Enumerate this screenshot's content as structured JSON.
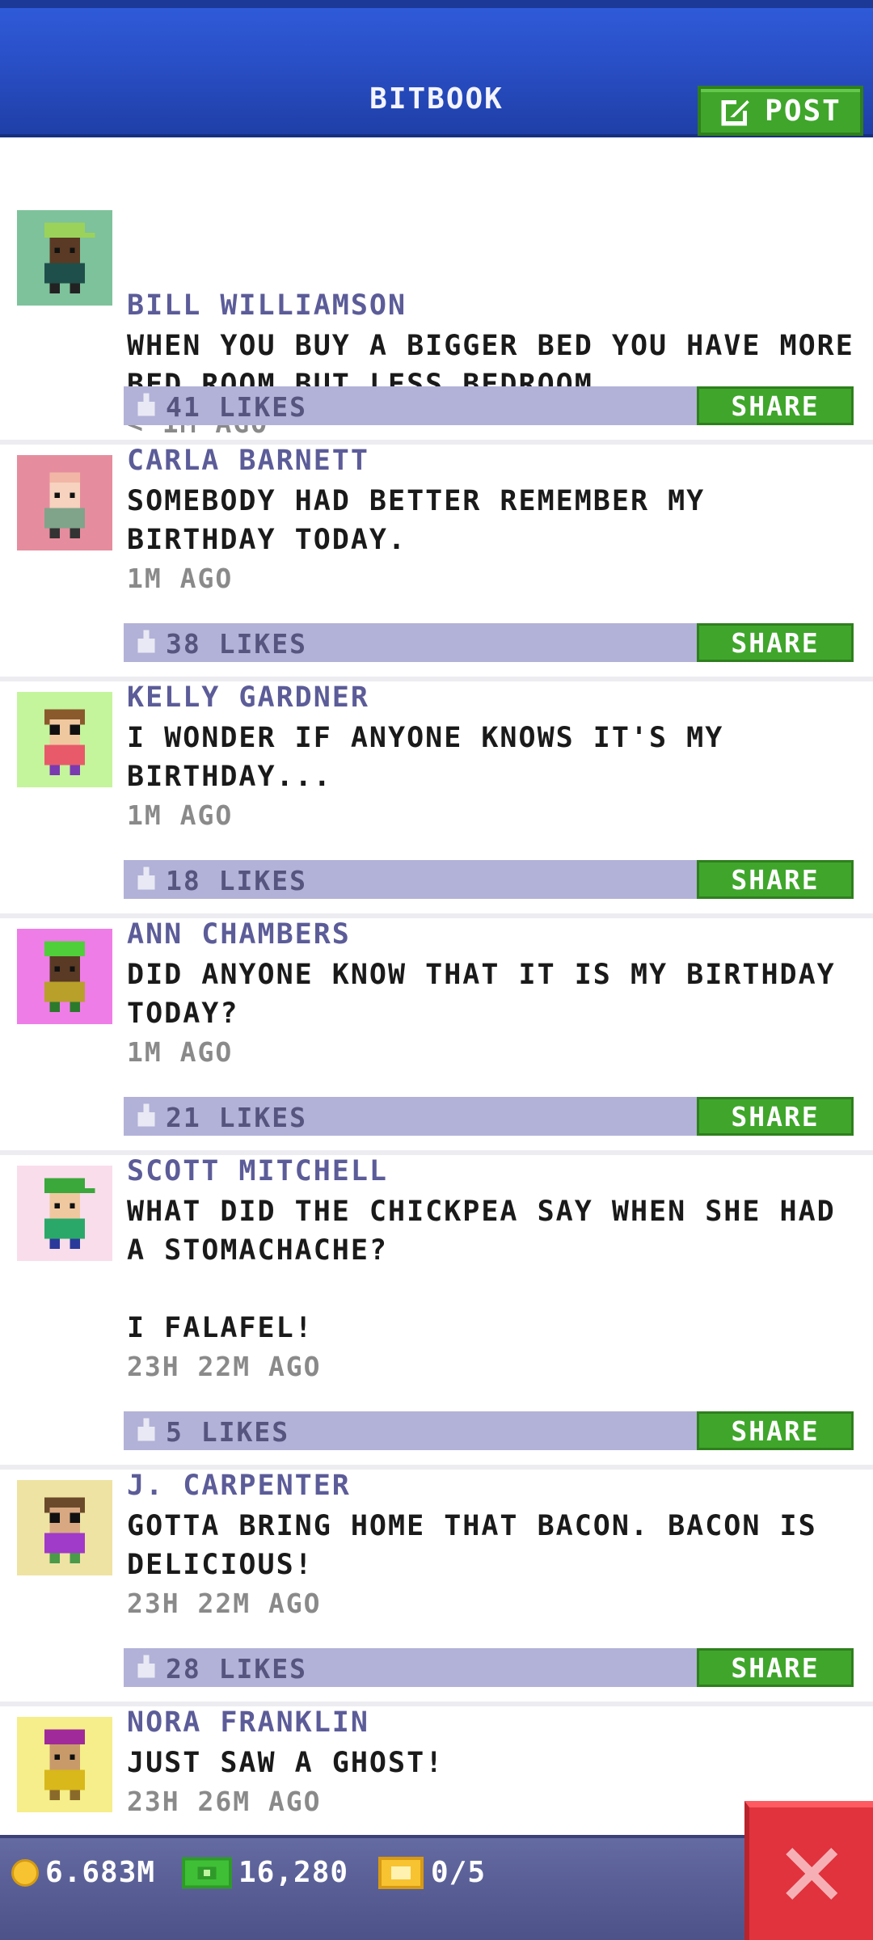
{
  "header": {
    "title": "BITBOOK",
    "post_label": "POST"
  },
  "posts": [
    {
      "name": "BILL WILLIAMSON",
      "message": "WHEN YOU BUY A BIGGER BED YOU HAVE MORE BED ROOM BUT LESS BEDROOM.",
      "time": "< 1M AGO",
      "likes": "41 LIKES",
      "share": "SHARE",
      "avatar_bg": "#7ec29b"
    },
    {
      "name": "CARLA BARNETT",
      "message": "SOMEBODY HAD BETTER REMEMBER MY BIRTHDAY TODAY.",
      "time": "1M AGO",
      "likes": "38 LIKES",
      "share": "SHARE",
      "avatar_bg": "#e58d9e"
    },
    {
      "name": "KELLY GARDNER",
      "message": "I WONDER IF ANYONE KNOWS IT'S MY BIRTHDAY...",
      "time": "1M AGO",
      "likes": "18 LIKES",
      "share": "SHARE",
      "avatar_bg": "#c4f59c"
    },
    {
      "name": "ANN CHAMBERS",
      "message": "DID ANYONE KNOW THAT IT IS MY BIRTHDAY TODAY?",
      "time": "1M AGO",
      "likes": "21 LIKES",
      "share": "SHARE",
      "avatar_bg": "#ef7de8"
    },
    {
      "name": "SCOTT MITCHELL",
      "message": "WHAT DID THE CHICKPEA SAY WHEN SHE HAD A STOMACHACHE?\n\nI FALAFEL!",
      "time": "23H 22M AGO",
      "likes": "5 LIKES",
      "share": "SHARE",
      "avatar_bg": "#f9ddeb"
    },
    {
      "name": "J. CARPENTER",
      "message": "GOTTA BRING HOME THAT BACON. BACON IS DELICIOUS!",
      "time": "23H 22M AGO",
      "likes": "28 LIKES",
      "share": "SHARE",
      "avatar_bg": "#efe3a3"
    },
    {
      "name": "NORA FRANKLIN",
      "message": "JUST SAW A GHOST!",
      "time": "23H 26M AGO",
      "likes": "",
      "share": "",
      "avatar_bg": "#f5ee8a"
    }
  ],
  "bottom_bar": {
    "coins": "6.683M",
    "bux": "16,280",
    "tickets": "0/5"
  },
  "colors": {
    "header_blue": "#2a50c8",
    "share_green": "#3fa62b",
    "like_bar": "#b2b2d8",
    "close_red": "#e0333d"
  }
}
